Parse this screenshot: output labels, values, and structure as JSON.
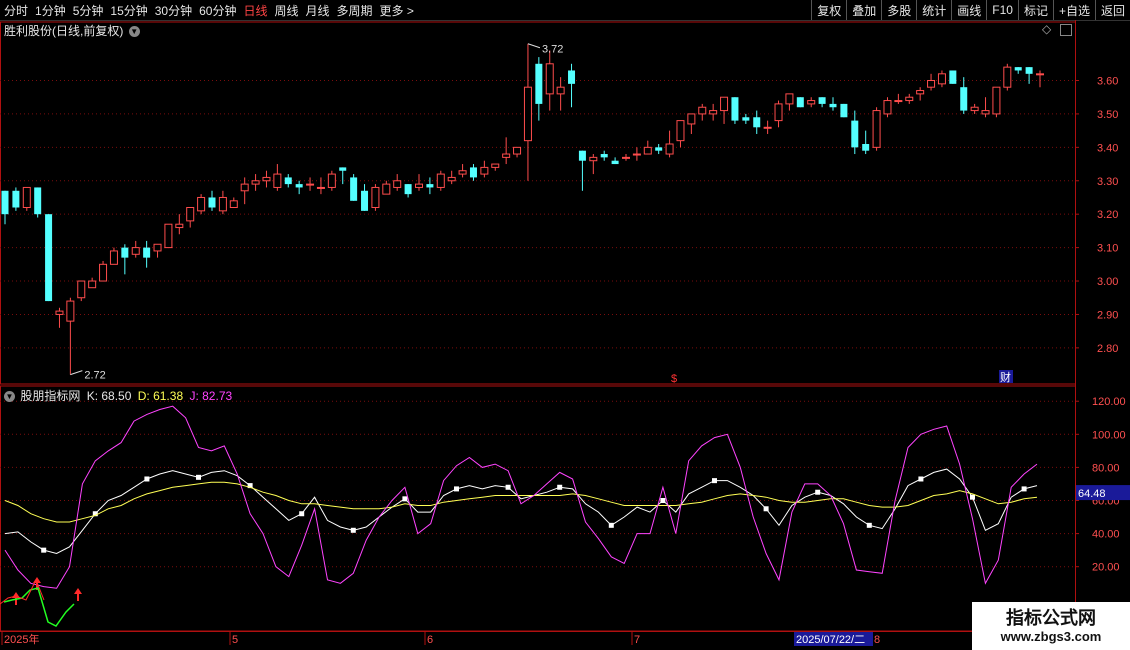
{
  "toolbar": {
    "periods": [
      "分时",
      "1分钟",
      "5分钟",
      "15分钟",
      "30分钟",
      "60分钟",
      "日线",
      "周线",
      "月线",
      "多周期",
      "更多 >"
    ],
    "active_period": "日线",
    "actions": [
      "复权",
      "叠加",
      "多股",
      "统计",
      "画线",
      "F10",
      "标记",
      "+自选",
      "返回"
    ]
  },
  "main_pane": {
    "title": "胜利股份(日线,前复权)",
    "high_label": "3.72",
    "low_label": "2.72",
    "marker_s": "$",
    "marker_cai": "财"
  },
  "indicator_pane": {
    "name": "股朋指标网",
    "k_label": "K: 68.50",
    "d_label": "D: 61.38",
    "j_label": "J: 82.73",
    "current_value_badge": "64.48"
  },
  "date_axis": {
    "labels": [
      "2025年",
      "5",
      "6",
      "7",
      "8"
    ],
    "cursor_date": "2025/07/22/二"
  },
  "watermark": {
    "title": "指标公式网",
    "url": "www.zbgs3.com"
  },
  "colors": {
    "up": "#ff4d4d",
    "down": "#54ffff",
    "k_line": "#ffffff",
    "d_line": "#ffff55",
    "j_line": "#ff44ff",
    "axis": "#b01010"
  },
  "chart_data": [
    {
      "type": "candlestick",
      "title": "胜利股份(日线,前复权)",
      "ylim": [
        2.72,
        3.72
      ],
      "y_ticks": [
        "3.60",
        "3.50",
        "3.40",
        "3.30",
        "3.20",
        "3.10",
        "3.00",
        "2.90",
        "2.80"
      ],
      "candles": [
        [
          3.27,
          3.27,
          3.17,
          3.2
        ],
        [
          3.27,
          3.28,
          3.21,
          3.22
        ],
        [
          3.22,
          3.28,
          3.21,
          3.28
        ],
        [
          3.28,
          3.28,
          3.19,
          3.2
        ],
        [
          3.2,
          3.2,
          2.94,
          2.94
        ],
        [
          2.9,
          2.92,
          2.86,
          2.91
        ],
        [
          2.88,
          2.95,
          2.72,
          2.94
        ],
        [
          2.95,
          3.0,
          2.94,
          3.0
        ],
        [
          2.98,
          3.01,
          2.98,
          3.0
        ],
        [
          3.0,
          3.06,
          3.0,
          3.05
        ],
        [
          3.05,
          3.1,
          3.05,
          3.09
        ],
        [
          3.1,
          3.11,
          3.02,
          3.07
        ],
        [
          3.08,
          3.12,
          3.07,
          3.1
        ],
        [
          3.1,
          3.12,
          3.04,
          3.07
        ],
        [
          3.09,
          3.11,
          3.07,
          3.11
        ],
        [
          3.1,
          3.17,
          3.1,
          3.17
        ],
        [
          3.16,
          3.2,
          3.14,
          3.17
        ],
        [
          3.18,
          3.22,
          3.16,
          3.22
        ],
        [
          3.21,
          3.26,
          3.2,
          3.25
        ],
        [
          3.25,
          3.27,
          3.21,
          3.22
        ],
        [
          3.21,
          3.27,
          3.2,
          3.25
        ],
        [
          3.22,
          3.25,
          3.22,
          3.24
        ],
        [
          3.27,
          3.31,
          3.23,
          3.29
        ],
        [
          3.29,
          3.32,
          3.27,
          3.3
        ],
        [
          3.3,
          3.33,
          3.28,
          3.31
        ],
        [
          3.28,
          3.35,
          3.27,
          3.32
        ],
        [
          3.31,
          3.32,
          3.28,
          3.29
        ],
        [
          3.29,
          3.3,
          3.26,
          3.28
        ],
        [
          3.29,
          3.31,
          3.27,
          3.29
        ],
        [
          3.28,
          3.31,
          3.26,
          3.28
        ],
        [
          3.28,
          3.33,
          3.27,
          3.32
        ],
        [
          3.34,
          3.34,
          3.29,
          3.33
        ],
        [
          3.31,
          3.32,
          3.24,
          3.24
        ],
        [
          3.27,
          3.29,
          3.21,
          3.21
        ],
        [
          3.22,
          3.29,
          3.21,
          3.28
        ],
        [
          3.26,
          3.3,
          3.26,
          3.29
        ],
        [
          3.28,
          3.32,
          3.27,
          3.3
        ],
        [
          3.29,
          3.29,
          3.25,
          3.26
        ],
        [
          3.28,
          3.32,
          3.27,
          3.29
        ],
        [
          3.29,
          3.31,
          3.26,
          3.28
        ],
        [
          3.28,
          3.33,
          3.27,
          3.32
        ],
        [
          3.3,
          3.33,
          3.29,
          3.31
        ],
        [
          3.32,
          3.35,
          3.31,
          3.33
        ],
        [
          3.34,
          3.35,
          3.3,
          3.31
        ],
        [
          3.32,
          3.36,
          3.31,
          3.34
        ],
        [
          3.34,
          3.35,
          3.33,
          3.35
        ],
        [
          3.37,
          3.43,
          3.35,
          3.38
        ],
        [
          3.38,
          3.4,
          3.37,
          3.4
        ],
        [
          3.42,
          3.71,
          3.3,
          3.58
        ],
        [
          3.65,
          3.67,
          3.48,
          3.53
        ],
        [
          3.56,
          3.69,
          3.51,
          3.65
        ],
        [
          3.56,
          3.61,
          3.51,
          3.58
        ],
        [
          3.63,
          3.65,
          3.52,
          3.59
        ],
        [
          3.39,
          3.39,
          3.27,
          3.36
        ],
        [
          3.36,
          3.38,
          3.32,
          3.37
        ],
        [
          3.38,
          3.39,
          3.36,
          3.37
        ],
        [
          3.36,
          3.37,
          3.35,
          3.35
        ],
        [
          3.37,
          3.38,
          3.36,
          3.37
        ],
        [
          3.38,
          3.4,
          3.36,
          3.38
        ],
        [
          3.38,
          3.42,
          3.38,
          3.4
        ],
        [
          3.4,
          3.41,
          3.38,
          3.39
        ],
        [
          3.38,
          3.45,
          3.37,
          3.41
        ],
        [
          3.42,
          3.45,
          3.4,
          3.48
        ],
        [
          3.47,
          3.5,
          3.44,
          3.5
        ],
        [
          3.5,
          3.53,
          3.48,
          3.52
        ],
        [
          3.5,
          3.53,
          3.48,
          3.51
        ],
        [
          3.51,
          3.55,
          3.47,
          3.55
        ],
        [
          3.55,
          3.55,
          3.47,
          3.48
        ],
        [
          3.49,
          3.5,
          3.47,
          3.48
        ],
        [
          3.49,
          3.51,
          3.44,
          3.46
        ],
        [
          3.46,
          3.48,
          3.44,
          3.46
        ],
        [
          3.48,
          3.54,
          3.46,
          3.53
        ],
        [
          3.53,
          3.56,
          3.51,
          3.56
        ],
        [
          3.55,
          3.55,
          3.52,
          3.52
        ],
        [
          3.53,
          3.55,
          3.52,
          3.54
        ],
        [
          3.55,
          3.55,
          3.52,
          3.53
        ],
        [
          3.53,
          3.55,
          3.51,
          3.52
        ],
        [
          3.53,
          3.53,
          3.49,
          3.49
        ],
        [
          3.48,
          3.51,
          3.38,
          3.4
        ],
        [
          3.41,
          3.45,
          3.38,
          3.39
        ],
        [
          3.4,
          3.52,
          3.39,
          3.51
        ],
        [
          3.5,
          3.55,
          3.49,
          3.54
        ],
        [
          3.54,
          3.56,
          3.53,
          3.54
        ],
        [
          3.54,
          3.56,
          3.53,
          3.55
        ],
        [
          3.56,
          3.58,
          3.54,
          3.57
        ],
        [
          3.58,
          3.62,
          3.57,
          3.6
        ],
        [
          3.59,
          3.63,
          3.58,
          3.62
        ],
        [
          3.63,
          3.63,
          3.59,
          3.59
        ],
        [
          3.58,
          3.61,
          3.5,
          3.51
        ],
        [
          3.51,
          3.53,
          3.5,
          3.52
        ],
        [
          3.5,
          3.55,
          3.49,
          3.51
        ],
        [
          3.5,
          3.58,
          3.49,
          3.58
        ],
        [
          3.58,
          3.65,
          3.57,
          3.64
        ],
        [
          3.64,
          3.64,
          3.62,
          3.63
        ],
        [
          3.64,
          3.64,
          3.59,
          3.62
        ],
        [
          3.62,
          3.63,
          3.58,
          3.62
        ]
      ]
    },
    {
      "type": "line",
      "title": "股朋指标网",
      "ylim": [
        0,
        130
      ],
      "y_ticks": [
        "120.00",
        "100.00",
        "80.00",
        "60.00",
        "40.00",
        "20.00"
      ],
      "series": [
        {
          "name": "K",
          "values": [
            40,
            41,
            35,
            30,
            28,
            32,
            42,
            52,
            60,
            63,
            68,
            73,
            76,
            78,
            76,
            74,
            77,
            78,
            75,
            69,
            62,
            55,
            48,
            52,
            62,
            48,
            44,
            42,
            44,
            50,
            56,
            61,
            53,
            53,
            63,
            67,
            69,
            67,
            69,
            68,
            61,
            63,
            65,
            68,
            67,
            58,
            53,
            45,
            50,
            56,
            53,
            60,
            53,
            64,
            68,
            72,
            72,
            68,
            63,
            55,
            45,
            57,
            62,
            65,
            63,
            58,
            50,
            45,
            43,
            55,
            69,
            73,
            77,
            79,
            73,
            62,
            42,
            46,
            62,
            67,
            69
          ]
        },
        {
          "name": "D",
          "values": [
            60,
            57,
            52,
            49,
            47,
            47,
            49,
            51,
            55,
            57,
            61,
            64,
            66,
            68,
            69,
            70,
            71,
            71,
            70,
            68,
            65,
            63,
            60,
            58,
            58,
            57,
            56,
            55,
            55,
            55,
            56,
            58,
            57,
            57,
            59,
            60,
            61,
            62,
            63,
            63,
            63,
            63,
            63,
            63,
            64,
            63,
            61,
            59,
            57,
            57,
            57,
            57,
            57,
            58,
            59,
            61,
            63,
            64,
            63,
            62,
            60,
            59,
            59,
            60,
            61,
            61,
            59,
            57,
            56,
            56,
            57,
            60,
            63,
            64,
            66,
            64,
            61,
            58,
            59,
            61,
            62
          ]
        },
        {
          "name": "J",
          "values": [
            30,
            18,
            10,
            8,
            7,
            20,
            70,
            84,
            90,
            95,
            108,
            112,
            115,
            117,
            110,
            92,
            90,
            93,
            76,
            52,
            40,
            20,
            14,
            33,
            55,
            12,
            10,
            16,
            36,
            50,
            60,
            68,
            40,
            46,
            72,
            81,
            86,
            80,
            82,
            78,
            58,
            63,
            70,
            77,
            73,
            47,
            37,
            26,
            22,
            40,
            40,
            68,
            40,
            84,
            93,
            98,
            100,
            80,
            50,
            28,
            12,
            53,
            70,
            70,
            63,
            46,
            18,
            17,
            16,
            60,
            92,
            100,
            103,
            105,
            82,
            49,
            10,
            24,
            68,
            76,
            82
          ]
        }
      ]
    }
  ]
}
